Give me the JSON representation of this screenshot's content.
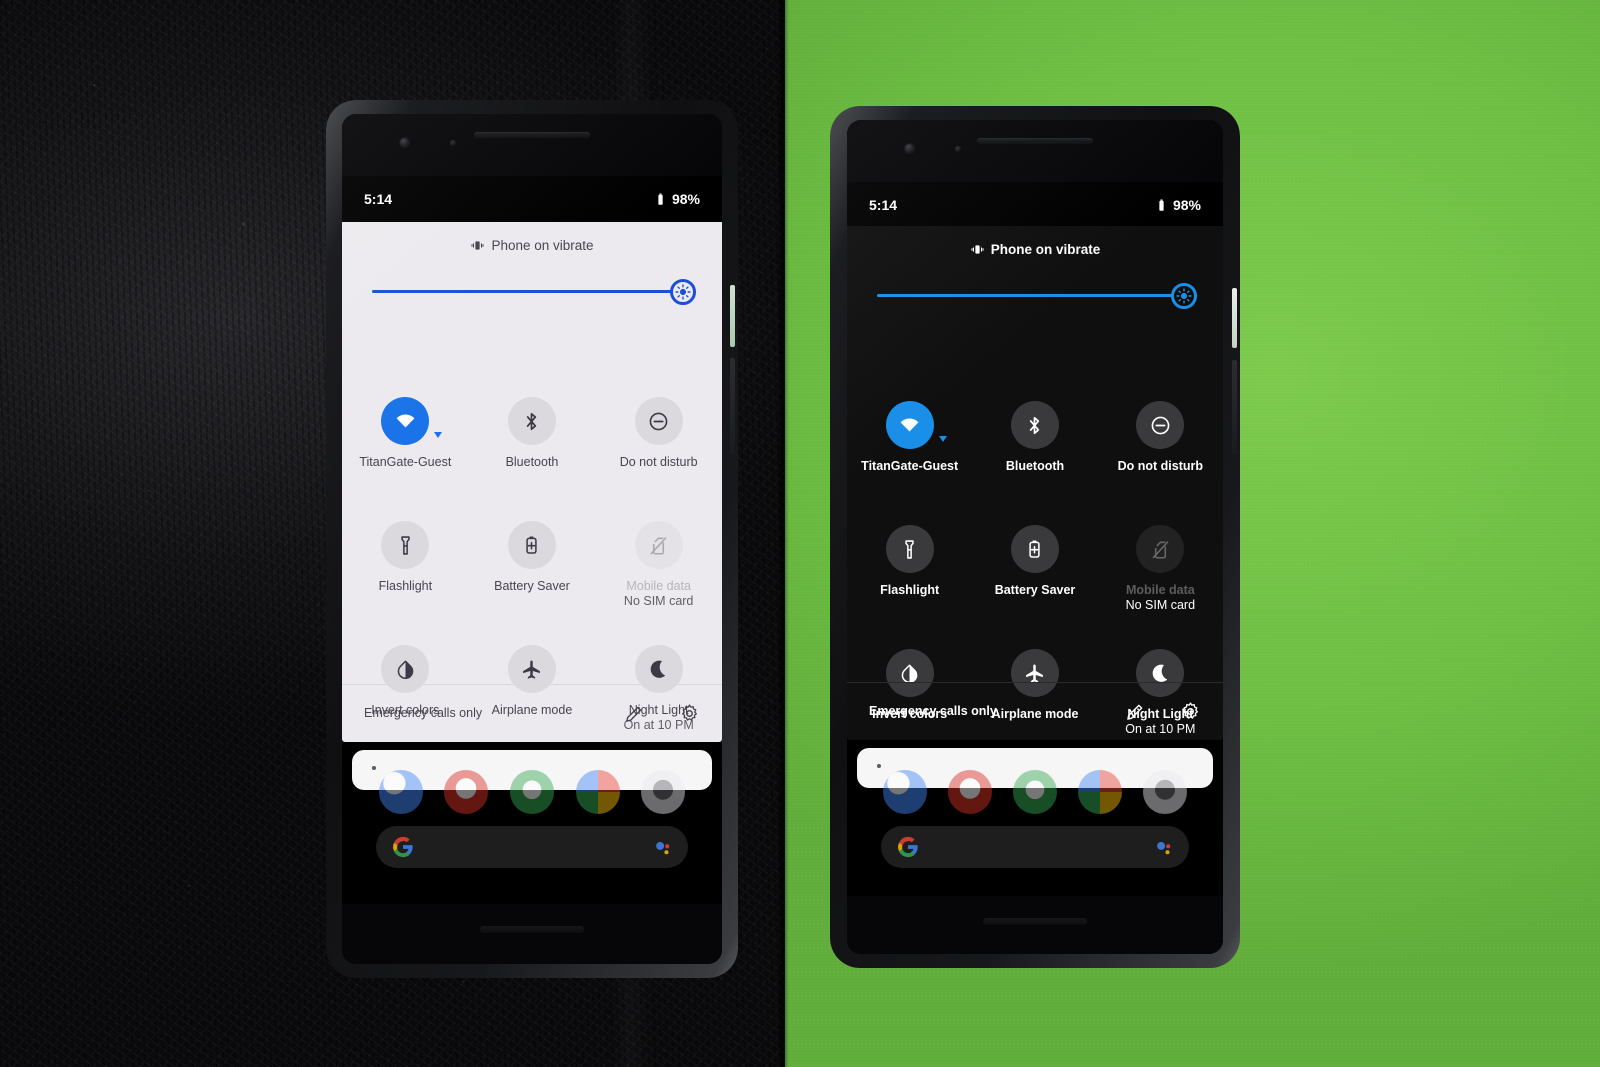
{
  "scene": {
    "description": "Two Pixel phones side by side showing Android Quick Settings in light theme and dark theme",
    "left_background": "black-leather",
    "right_background": "green-paper",
    "green_hex": "#6fc044",
    "leather_hex": "#131316"
  },
  "phones": [
    {
      "id": "left-phone",
      "theme": "light",
      "colors": {
        "shade_bg": "#eceaee",
        "text_primary": "#4a4450",
        "text_secondary": "#8e8794",
        "tile_off_bg": "#dcd9de",
        "tile_icon": "#3f3945",
        "tile_on_bg": "#1a73e8",
        "tile_on_icon": "#ffffff",
        "slider": "#1c4fd8",
        "divider": "#dad7dc"
      },
      "status_bar": {
        "time": "5:14",
        "battery_percent": "98%",
        "battery_icon": "battery-full-icon"
      },
      "header": {
        "ringer_icon": "vibrate-icon",
        "ringer_label": "Phone on vibrate"
      },
      "brightness": {
        "icon": "brightness-icon",
        "value_percent": 97
      },
      "tiles": [
        {
          "label": "TitanGate-Guest",
          "sub": "",
          "icon": "wifi-icon",
          "state": "on",
          "has_caret": true,
          "disabled": false
        },
        {
          "label": "Bluetooth",
          "sub": "",
          "icon": "bluetooth-icon",
          "state": "off",
          "has_caret": false,
          "disabled": false
        },
        {
          "label": "Do not disturb",
          "sub": "",
          "icon": "do-not-disturb-icon",
          "state": "off",
          "has_caret": false,
          "disabled": false
        },
        {
          "label": "Flashlight",
          "sub": "",
          "icon": "flashlight-icon",
          "state": "off",
          "has_caret": false,
          "disabled": false
        },
        {
          "label": "Battery Saver",
          "sub": "",
          "icon": "battery-saver-icon",
          "state": "off",
          "has_caret": false,
          "disabled": false
        },
        {
          "label": "Mobile data",
          "sub": "No SIM card",
          "icon": "no-sim-icon",
          "state": "off",
          "has_caret": false,
          "disabled": true
        },
        {
          "label": "Invert colors",
          "sub": "",
          "icon": "invert-colors-icon",
          "state": "off",
          "has_caret": false,
          "disabled": false
        },
        {
          "label": "Airplane mode",
          "sub": "",
          "icon": "airplane-icon",
          "state": "off",
          "has_caret": false,
          "disabled": false
        },
        {
          "label": "Night Light",
          "sub": "On at 10 PM",
          "icon": "night-light-icon",
          "state": "off",
          "has_caret": false,
          "disabled": false
        }
      ],
      "footer": {
        "carrier": "Emergency calls only",
        "edit_icon": "pencil-icon",
        "settings_icon": "gear-icon"
      },
      "notification_card": {
        "dot": "notification-dot"
      },
      "dock": {
        "icons": [
          "app-icon-blue",
          "app-icon-red",
          "app-icon-maps",
          "app-icon-chrome",
          "app-icon-camera"
        ]
      },
      "search": {
        "logo": "google-g-icon",
        "assistant": "google-assistant-icon"
      },
      "nav": {
        "back": "back-chevron-icon",
        "home": "home-pill"
      }
    },
    {
      "id": "right-phone",
      "theme": "dark",
      "colors": {
        "shade_bg": "#0f0f10",
        "text_primary": "#ffffff",
        "text_secondary": "#9b9b9e",
        "tile_off_bg": "#3a3a3c",
        "tile_icon": "#ffffff",
        "tile_on_bg": "#1a8fe8",
        "tile_on_icon": "#ffffff",
        "slider": "#1a8fe8",
        "divider": "#2a2a2c"
      },
      "status_bar": {
        "time": "5:14",
        "battery_percent": "98%",
        "battery_icon": "battery-full-icon"
      },
      "header": {
        "ringer_icon": "vibrate-icon",
        "ringer_label": "Phone on vibrate"
      },
      "brightness": {
        "icon": "brightness-icon",
        "value_percent": 97
      },
      "tiles": [
        {
          "label": "TitanGate-Guest",
          "sub": "",
          "icon": "wifi-icon",
          "state": "on",
          "has_caret": true,
          "disabled": false
        },
        {
          "label": "Bluetooth",
          "sub": "",
          "icon": "bluetooth-icon",
          "state": "off",
          "has_caret": false,
          "disabled": false
        },
        {
          "label": "Do not disturb",
          "sub": "",
          "icon": "do-not-disturb-icon",
          "state": "off",
          "has_caret": false,
          "disabled": false
        },
        {
          "label": "Flashlight",
          "sub": "",
          "icon": "flashlight-icon",
          "state": "off",
          "has_caret": false,
          "disabled": false
        },
        {
          "label": "Battery Saver",
          "sub": "",
          "icon": "battery-saver-icon",
          "state": "off",
          "has_caret": false,
          "disabled": false
        },
        {
          "label": "Mobile data",
          "sub": "No SIM card",
          "icon": "no-sim-icon",
          "state": "off",
          "has_caret": false,
          "disabled": true
        },
        {
          "label": "Invert colors",
          "sub": "",
          "icon": "invert-colors-icon",
          "state": "off",
          "has_caret": false,
          "disabled": false
        },
        {
          "label": "Airplane mode",
          "sub": "",
          "icon": "airplane-icon",
          "state": "off",
          "has_caret": false,
          "disabled": false
        },
        {
          "label": "Night Light",
          "sub": "On at 10 PM",
          "icon": "night-light-icon",
          "state": "off",
          "has_caret": false,
          "disabled": false
        }
      ],
      "footer": {
        "carrier": "Emergency calls only",
        "edit_icon": "pencil-icon",
        "settings_icon": "gear-icon"
      },
      "notification_card": {
        "dot": "notification-dot"
      },
      "dock": {
        "icons": [
          "app-icon-blue",
          "app-icon-red",
          "app-icon-maps",
          "app-icon-chrome",
          "app-icon-camera"
        ]
      },
      "search": {
        "logo": "google-g-icon",
        "assistant": "google-assistant-icon"
      },
      "nav": {
        "back": "back-chevron-icon",
        "home": "home-pill"
      }
    }
  ]
}
